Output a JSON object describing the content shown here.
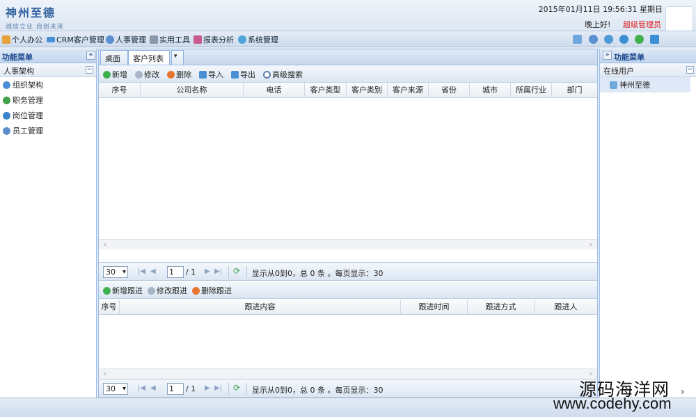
{
  "header": {
    "logo_title": "神州至德",
    "logo_slogan": "诚信立业 自创未来",
    "datetime": "2015年01月11日 19:56:31 星期日",
    "greeting": "晚上好!",
    "role": "超级管理员"
  },
  "menubar": {
    "items": [
      "个人办公",
      "CRM客户管理",
      "人事管理",
      "实用工具",
      "报表分析",
      "系统管理"
    ],
    "icons": [
      "home-icon",
      "card-icon",
      "user-icon",
      "tools-icon",
      "chart-icon",
      "gear-icon"
    ]
  },
  "left": {
    "title": "功能菜单",
    "section": "人事架构",
    "items": [
      "组织架构",
      "职务管理",
      "岗位管理",
      "员工管理"
    ]
  },
  "tabs": [
    "桌面",
    "客户列表"
  ],
  "toolbar": [
    "新增",
    "修改",
    "删除",
    "导入",
    "导出",
    "高级搜索"
  ],
  "grid": {
    "columns": [
      "序号",
      "公司名称",
      "电话",
      "客户类型",
      "客户类别",
      "客户来源",
      "省份",
      "城市",
      "所属行业",
      "部门"
    ]
  },
  "pager1": {
    "page_size": "30",
    "page": "1",
    "total_pages": "/ 1",
    "info": "显示从0到0，总 0 条 。每页显示：30"
  },
  "follow_toolbar": [
    "新增跟进",
    "修改跟进",
    "删除跟进"
  ],
  "follow_grid": {
    "columns": [
      "序号",
      "跟进内容",
      "跟进时间",
      "跟进方式",
      "跟进人"
    ]
  },
  "pager2": {
    "page_size": "30",
    "page": "1",
    "total_pages": "/ 1",
    "info": "显示从0到0，总 0 条 。每页显示：30"
  },
  "right": {
    "title": "功能菜单",
    "section": "在线用户",
    "users": [
      "神州至德"
    ]
  },
  "watermark": {
    "line1": "源码海洋网",
    "line2": "www.codehy.com"
  },
  "colors": {
    "accent": "#15428b",
    "border": "#99bbe8",
    "role_red": "#e02020"
  }
}
